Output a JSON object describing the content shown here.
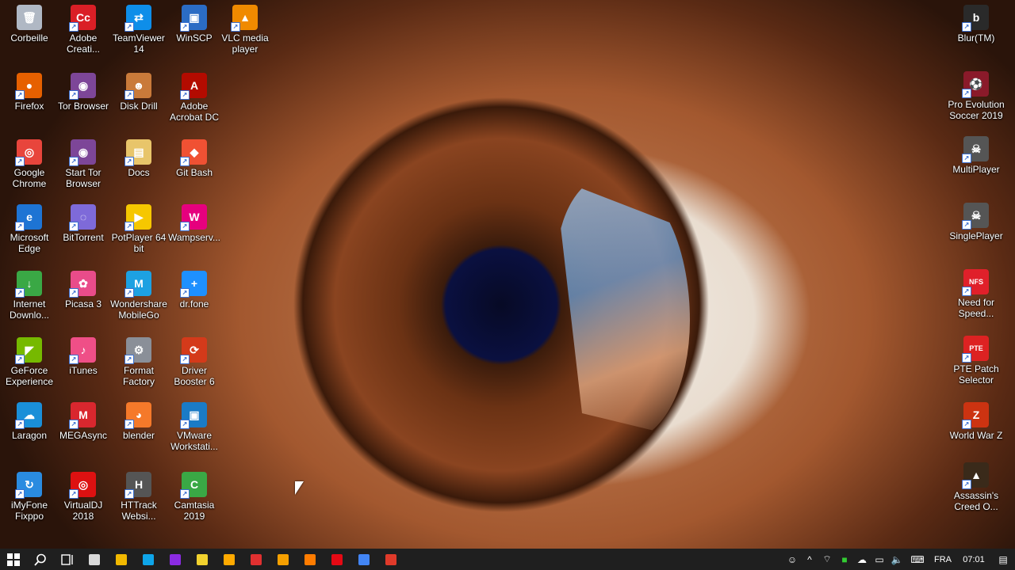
{
  "desktop": {
    "icons": [
      {
        "label": "Corbeille",
        "color": "#b0b8c4",
        "glyph": "🗑"
      },
      {
        "label": "Adobe Creati...",
        "color": "#da1f26",
        "glyph": "Cc"
      },
      {
        "label": "TeamViewer 14",
        "color": "#0e8ee9",
        "glyph": "⇄"
      },
      {
        "label": "WinSCP",
        "color": "#2b6cc4",
        "glyph": "▣"
      },
      {
        "label": "VLC media player",
        "color": "#f08a00",
        "glyph": "▲"
      },
      {
        "label": "Firefox",
        "color": "#e66000",
        "glyph": "●"
      },
      {
        "label": "Tor Browser",
        "color": "#7d4698",
        "glyph": "◉"
      },
      {
        "label": "Disk Drill",
        "color": "#c97a3a",
        "glyph": "☻"
      },
      {
        "label": "Adobe Acrobat DC",
        "color": "#b30b00",
        "glyph": "A"
      },
      {
        "label": "Google Chrome",
        "color": "#e8453c",
        "glyph": "◎"
      },
      {
        "label": "Start Tor Browser",
        "color": "#7d4698",
        "glyph": "◉"
      },
      {
        "label": "Docs",
        "color": "#e8c56a",
        "glyph": "▤"
      },
      {
        "label": "Git Bash",
        "color": "#f05133",
        "glyph": "◆"
      },
      {
        "label": "Microsoft Edge",
        "color": "#1e74d4",
        "glyph": "e"
      },
      {
        "label": "BitTorrent",
        "color": "#7e6ad9",
        "glyph": "◌"
      },
      {
        "label": "PotPlayer 64 bit",
        "color": "#f6c700",
        "glyph": "▶"
      },
      {
        "label": "Wampserv...",
        "color": "#e6007e",
        "glyph": "W"
      },
      {
        "label": "Internet Downlo...",
        "color": "#3aa845",
        "glyph": "↓"
      },
      {
        "label": "Picasa 3",
        "color": "#e94c8a",
        "glyph": "✿"
      },
      {
        "label": "Wondershare MobileGo",
        "color": "#1da1e2",
        "glyph": "M"
      },
      {
        "label": "dr.fone",
        "color": "#1e90ff",
        "glyph": "+"
      },
      {
        "label": "GeForce Experience",
        "color": "#76b900",
        "glyph": "◤"
      },
      {
        "label": "iTunes",
        "color": "#ef4f87",
        "glyph": "♪"
      },
      {
        "label": "Format Factory",
        "color": "#8a8f98",
        "glyph": "⚙"
      },
      {
        "label": "Driver Booster 6",
        "color": "#d43a1a",
        "glyph": "⟳"
      },
      {
        "label": "Laragon",
        "color": "#1a8fd8",
        "glyph": "☁"
      },
      {
        "label": "MEGAsync",
        "color": "#d9272e",
        "glyph": "M"
      },
      {
        "label": "blender",
        "color": "#f5792a",
        "glyph": "◕"
      },
      {
        "label": "VMware Workstati...",
        "color": "#1a7bc6",
        "glyph": "▣"
      },
      {
        "label": "iMyFone Fixppo",
        "color": "#2a8be0",
        "glyph": "↻"
      },
      {
        "label": "VirtualDJ 2018",
        "color": "#d11",
        "glyph": "◎"
      },
      {
        "label": "HTTrack Websi...",
        "color": "#555",
        "glyph": "H"
      },
      {
        "label": "Camtasia 2019",
        "color": "#3aa845",
        "glyph": "C"
      }
    ],
    "right_icons": [
      {
        "label": "Blur(TM)",
        "color": "#2a2a2a",
        "glyph": "b"
      },
      {
        "label": "Pro Evolution Soccer 2019",
        "color": "#8a1a2a",
        "glyph": "⚽"
      },
      {
        "label": "MultiPlayer",
        "color": "#555",
        "glyph": "☠"
      },
      {
        "label": "SinglePlayer",
        "color": "#555",
        "glyph": "☠"
      },
      {
        "label": "Need for Speed...",
        "color": "#e0202a",
        "glyph": "NFS"
      },
      {
        "label": "PTE Patch Selector",
        "color": "#d22",
        "glyph": "PTE"
      },
      {
        "label": "World War Z",
        "color": "#c31",
        "glyph": "Z"
      },
      {
        "label": "Assassin's Creed O...",
        "color": "#3a2a1a",
        "glyph": "▲"
      }
    ]
  },
  "taskbar": {
    "start_icon": "windows-logo",
    "pinned_colors": [
      "#d9d9d9",
      "#f2b900",
      "#0ea5e9",
      "#8a2be2",
      "#f2d22e",
      "#ffaa00",
      "#e03030",
      "#f6a000",
      "#ff7c00",
      "#e50914",
      "#4285f4",
      "#e03a2a"
    ],
    "language": "FRA",
    "time": "07:01"
  }
}
